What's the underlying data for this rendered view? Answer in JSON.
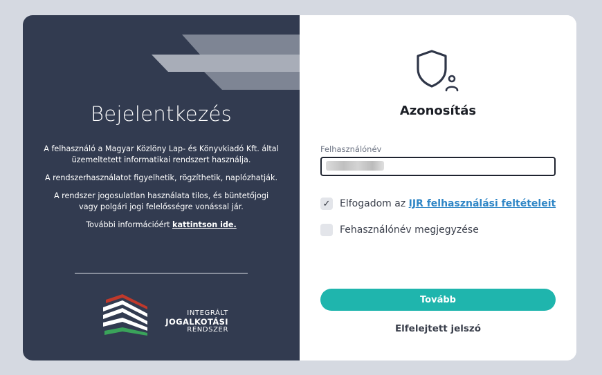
{
  "left": {
    "title": "Bejelentkezés",
    "paragraphs": [
      "A felhasználó a Magyar Közlöny Lap- és Könyvkiadó Kft. által üzemeltetett informatikai rendszert használja.",
      "A rendszerhasználatot figyelhetik, rögzíthetik, naplózhatják.",
      "A rendszer jogosulatlan használata tilos, és büntetőjogi vagy polgári jogi felelősségre vonással jár."
    ],
    "info_prefix": "További információért ",
    "info_link": "kattintson ide.",
    "logo": {
      "line1": "INTEGRÁLT",
      "line2": "JOGALKOTÁSI",
      "line3": "RENDSZER"
    }
  },
  "right": {
    "title": "Azonosítás",
    "username_label": "Felhasználónév",
    "username_value": "",
    "accept_prefix": "Elfogadom az ",
    "accept_link": "IJR felhasználási feltételeit",
    "accept_checked": true,
    "remember_label": "Fehasználónév megjegyzése",
    "remember_checked": false,
    "submit_label": "Tovább",
    "forgot_label": "Elfelejtett jelszó",
    "check_glyph": "✓"
  },
  "colors": {
    "background": "#d5d9e1",
    "panel_dark": "#323b50",
    "accent_button": "#1fb5ad",
    "link": "#2f86c6"
  }
}
